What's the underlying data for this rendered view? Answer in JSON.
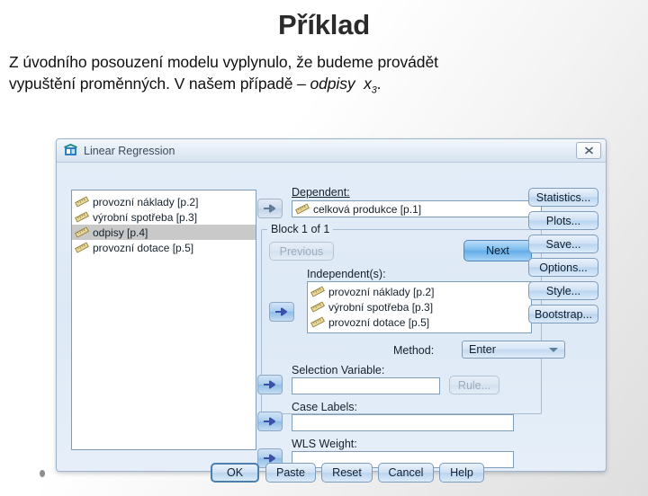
{
  "slide": {
    "title": "Příklad",
    "body_line1": "Z úvodního  posouzení modelu vyplynulo, že budeme provádět",
    "body_line2_pre": "vypuštění proměnných. V našem případě – ",
    "body_line2_em": "odpisy",
    "body_line2_var": "x",
    "body_line2_sub": "3",
    "body_line2_end": "."
  },
  "dialog": {
    "title": "Linear Regression",
    "icon": "spss-regression-icon",
    "close_icon": "close-icon",
    "source_variables": [
      {
        "label": "provozní náklady [p.2]",
        "icon": "scale-ruler-icon",
        "selected": false
      },
      {
        "label": "výrobní spotřeba [p.3]",
        "icon": "scale-ruler-icon",
        "selected": false
      },
      {
        "label": "odpisy [p.4]",
        "icon": "scale-ruler-icon",
        "selected": true
      },
      {
        "label": "provozní dotace [p.5]",
        "icon": "scale-ruler-icon",
        "selected": false
      }
    ],
    "dependent": {
      "label": "Dependent:",
      "value": "celková produkce [p.1]",
      "icon": "scale-ruler-icon",
      "arrow_icon": "arrow-right-icon"
    },
    "block": {
      "title": "Block 1 of 1",
      "previous_label": "Previous",
      "next_label": "Next"
    },
    "independents": {
      "label": "Independent(s):",
      "arrow_icon": "arrow-right-icon",
      "items": [
        {
          "label": "provozní náklady [p.2]",
          "icon": "scale-ruler-icon"
        },
        {
          "label": "výrobní spotřeba [p.3]",
          "icon": "scale-ruler-icon"
        },
        {
          "label": "provozní dotace [p.5]",
          "icon": "scale-ruler-icon"
        }
      ]
    },
    "method": {
      "label": "Method:",
      "value": "Enter"
    },
    "selection_variable": {
      "label": "Selection Variable:",
      "value": "",
      "rule_label": "Rule...",
      "arrow_icon": "arrow-right-icon"
    },
    "case_labels": {
      "label": "Case Labels:",
      "value": "",
      "arrow_icon": "arrow-right-icon"
    },
    "wls_weight": {
      "label": "WLS Weight:",
      "value": "",
      "arrow_icon": "arrow-right-icon"
    },
    "side_buttons": [
      {
        "label": "Statistics..."
      },
      {
        "label": "Plots..."
      },
      {
        "label": "Save..."
      },
      {
        "label": "Options..."
      },
      {
        "label": "Style..."
      },
      {
        "label": "Bootstrap..."
      }
    ],
    "bottom_buttons": [
      {
        "label": "OK"
      },
      {
        "label": "Paste"
      },
      {
        "label": "Reset"
      },
      {
        "label": "Cancel"
      },
      {
        "label": "Help"
      }
    ]
  },
  "colors": {
    "dialog_bg": "#dfeaf7",
    "accent_blue": "#7ebdee",
    "selection_gray": "#c9c9c9",
    "title_text": "#2b2b2b"
  }
}
